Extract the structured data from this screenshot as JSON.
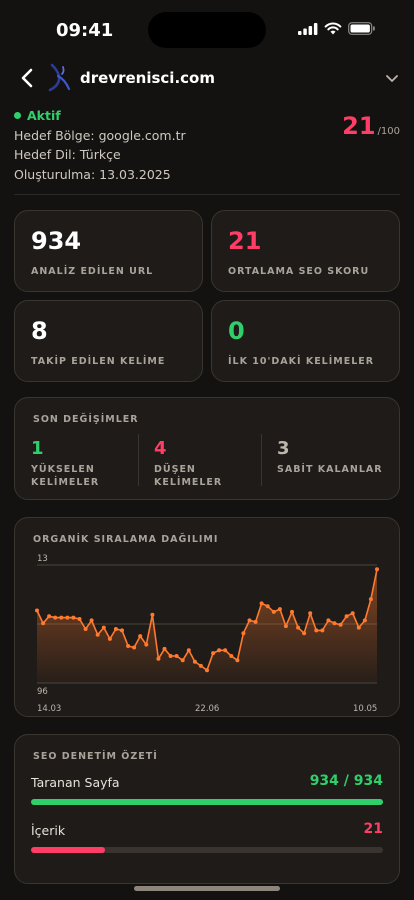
{
  "status_bar": {
    "time": "09:41"
  },
  "header": {
    "domain": "drevrenisci.com"
  },
  "info": {
    "status": "Aktif",
    "region": "Hedef Bölge: google.com.tr",
    "language": "Hedef Dil: Türkçe",
    "created": "Oluşturulma: 13.03.2025"
  },
  "score": {
    "value": "21",
    "max": "/100"
  },
  "stats": [
    {
      "value": "934",
      "label": "ANALİZ EDİLEN URL",
      "color": "#ffffff"
    },
    {
      "value": "21",
      "label": "ORTALAMA SEO SKORU",
      "color": "#ff3d67"
    },
    {
      "value": "8",
      "label": "TAKİP EDİLEN KELİME",
      "color": "#ffffff"
    },
    {
      "value": "0",
      "label": "İLK 10'DAKİ KELİMELER",
      "color": "#2fd06b"
    }
  ],
  "changes": {
    "title": "SON DEĞİŞİMLER",
    "items": [
      {
        "value": "1",
        "label_line1": "YÜKSELEN",
        "label_line2": "KELİMELER",
        "color": "#2fd06b"
      },
      {
        "value": "4",
        "label_line1": "DÜŞEN",
        "label_line2": "KELİMELER",
        "color": "#ff3d67"
      },
      {
        "value": "3",
        "label_line1": "SABİT KALANLAR",
        "label_line2": "",
        "color": "#bdb6ac"
      }
    ]
  },
  "ranking_chart": {
    "title": "ORGANİK SIRALAMA DAĞILIMI",
    "y_top_label": "13",
    "y_bottom_label": "96",
    "x_labels": [
      "14.03",
      "22.06",
      "10.05"
    ]
  },
  "chart_data": {
    "type": "line",
    "title": "ORGANİK SIRALAMA DAĞILIMI",
    "ylim": [
      13,
      96
    ],
    "y_inverted": true,
    "x_tick_labels": [
      "14.03",
      "22.06",
      "10.05"
    ],
    "series": [
      {
        "values": [
          45,
          54,
          49,
          50,
          50,
          50,
          50,
          51,
          58,
          52,
          62,
          57,
          65,
          58,
          59,
          70,
          71,
          63,
          69,
          48,
          79,
          72,
          77,
          77,
          80,
          73,
          81,
          84,
          87,
          75,
          73,
          73,
          77,
          80,
          61,
          52,
          53,
          40,
          42,
          46,
          44,
          56,
          46,
          57,
          61,
          47,
          59,
          59,
          52,
          54,
          55,
          49,
          47,
          57,
          52,
          37,
          16
        ],
        "color": "#ff7a2f"
      }
    ]
  },
  "audit": {
    "title": "SEO DENETİM ÖZETİ",
    "rows": [
      {
        "label": "Taranan Sayfa",
        "value": "934 / 934",
        "fraction": 1.0,
        "color": "#2fd06b"
      },
      {
        "label": "İçerik",
        "value": "21",
        "fraction": 0.21,
        "color": "#ff3d67"
      }
    ]
  },
  "icons": [
    "back-icon",
    "brand-logo-icon",
    "chevron-down-icon",
    "signal-icon",
    "wifi-icon",
    "battery-icon"
  ]
}
